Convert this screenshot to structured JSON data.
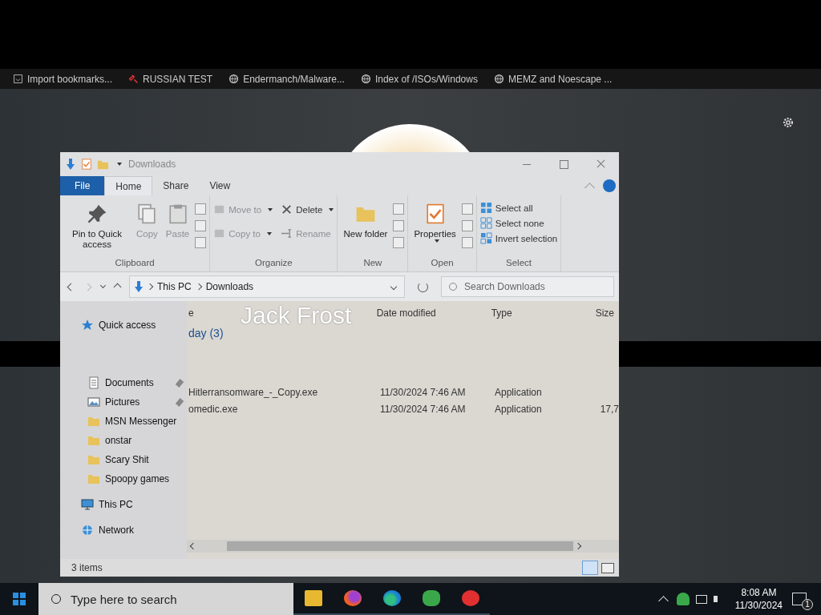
{
  "bookmarks": [
    {
      "label": "Import bookmarks..."
    },
    {
      "label": "RUSSIAN TEST"
    },
    {
      "label": "Endermanch/Malware..."
    },
    {
      "label": "Index of /ISOs/Windows"
    },
    {
      "label": "MEMZ and Noescape ..."
    }
  ],
  "explorer": {
    "title": "Downloads",
    "tabs": [
      {
        "label": "File",
        "kind": "file",
        "selected": false
      },
      {
        "label": "Home",
        "kind": "tab",
        "selected": true
      },
      {
        "label": "Share",
        "kind": "tab",
        "selected": false
      },
      {
        "label": "View",
        "kind": "tab",
        "selected": false
      }
    ],
    "ribbon": [
      {
        "label": "Clipboard",
        "items": [
          {
            "kind": "large",
            "label": "Pin to Quick access",
            "disabled": false,
            "caret": false
          },
          {
            "kind": "large",
            "label": "Copy",
            "disabled": true,
            "caret": false
          },
          {
            "kind": "large",
            "label": "Paste",
            "disabled": true,
            "caret": false
          },
          {
            "kind": "icons"
          }
        ]
      },
      {
        "label": "Organize",
        "items": [
          {
            "kind": "small",
            "label": "Move to",
            "disabled": true,
            "caret": true
          },
          {
            "kind": "small",
            "label": "Copy to",
            "disabled": true,
            "caret": true
          },
          {
            "kind": "small",
            "label": "Delete",
            "disabled": false,
            "caret": true
          },
          {
            "kind": "small",
            "label": "Rename",
            "disabled": true,
            "caret": false
          }
        ]
      },
      {
        "label": "New",
        "items": [
          {
            "kind": "large",
            "label": "New folder",
            "disabled": false,
            "caret": false
          },
          {
            "kind": "icons"
          }
        ]
      },
      {
        "label": "Open",
        "items": [
          {
            "kind": "large",
            "label": "Properties",
            "disabled": false,
            "caret": true
          },
          {
            "kind": "icons"
          }
        ]
      },
      {
        "label": "Select",
        "items": [
          {
            "kind": "small",
            "label": "Select all",
            "disabled": false,
            "caret": false
          },
          {
            "kind": "small",
            "label": "Select none",
            "disabled": false,
            "caret": false
          },
          {
            "kind": "small",
            "label": "Invert selection",
            "disabled": false,
            "caret": false
          }
        ]
      }
    ],
    "crumbs": [
      "This PC",
      "Downloads"
    ],
    "search": {
      "placeholder": "Search Downloads"
    },
    "nav": [
      {
        "label": "Quick access",
        "children": [
          {
            "label": "Documents",
            "pinned": true
          },
          {
            "label": "Pictures",
            "pinned": true
          },
          {
            "label": "MSN Messenger",
            "pinned": false
          },
          {
            "label": "onstar",
            "pinned": false
          },
          {
            "label": "Scary Shit",
            "pinned": false
          },
          {
            "label": "Spoopy games",
            "pinned": false
          }
        ]
      },
      {
        "label": "This PC"
      },
      {
        "label": "Network"
      }
    ],
    "columns": [
      "e",
      "Date modified",
      "Type",
      "Size"
    ],
    "group_header": "day (3)",
    "rows": [
      {
        "name": "Hitlerransomware_-_Copy.exe",
        "date": "11/30/2024 7:46 AM",
        "type": "Application"
      },
      {
        "name": "omedic.exe",
        "date": "11/30/2024 7:46 AM",
        "type": "Application",
        "size": "17,7"
      }
    ],
    "status": "3 items"
  },
  "login": {
    "user_name": "Jack Frost"
  },
  "taskbar": {
    "search_placeholder": "Type here to search",
    "time": "8:08 AM",
    "date": "11/30/2024",
    "notification_count": "1"
  }
}
